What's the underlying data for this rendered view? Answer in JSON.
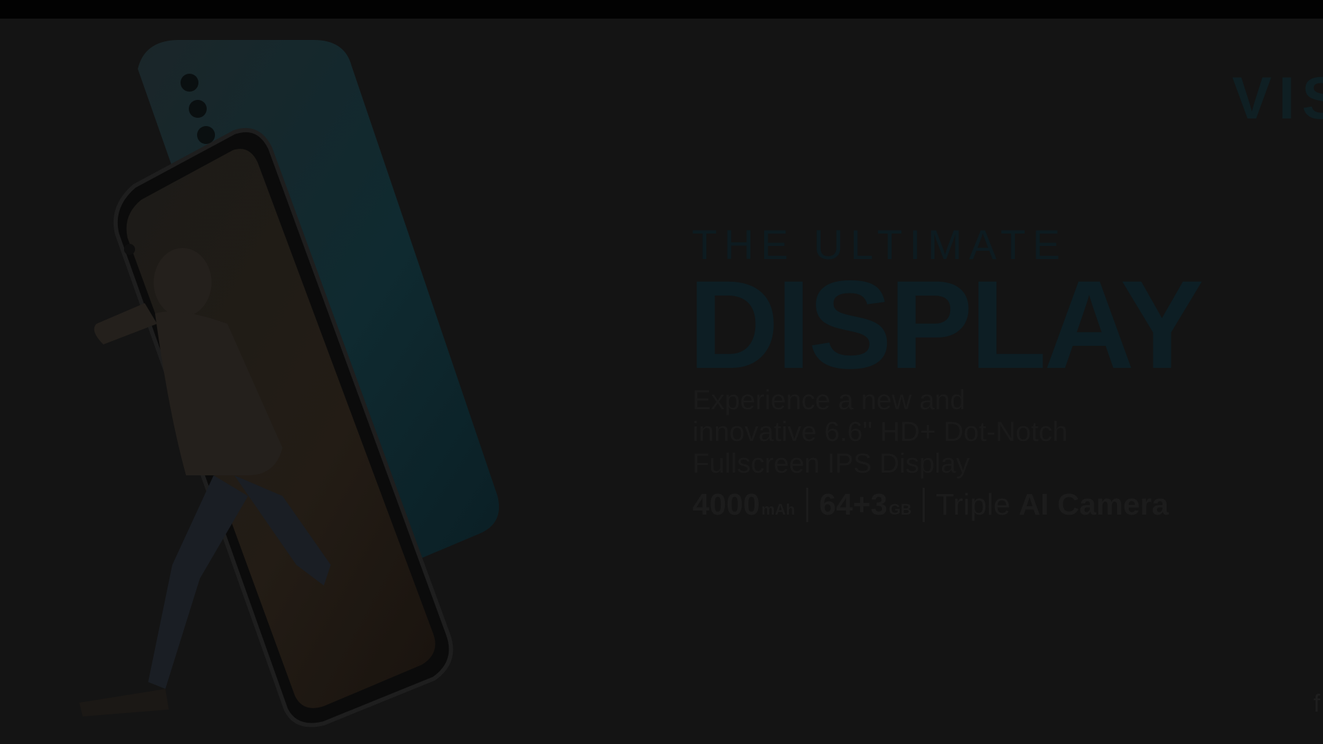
{
  "ad": {
    "brand": "VIS",
    "tagline": "THE ULTIMATE",
    "headline": "DISPLAY",
    "description": "Experience a new and\ninnovative 6.6\" HD+ Dot-Notch\nFullscreen IPS Display",
    "specs": {
      "battery_value": "4000",
      "battery_unit": "mAh",
      "memory_value": "64+3",
      "memory_unit": "GB",
      "camera_prefix": "Triple",
      "camera_highlight": "AI Camera"
    },
    "edge_glyph": "f"
  },
  "colors": {
    "background": "#141414",
    "top_bar": "#020202",
    "headline": "#0d1e24",
    "body_text": "#1a1a1a",
    "phone_back": "#0f2a30"
  }
}
